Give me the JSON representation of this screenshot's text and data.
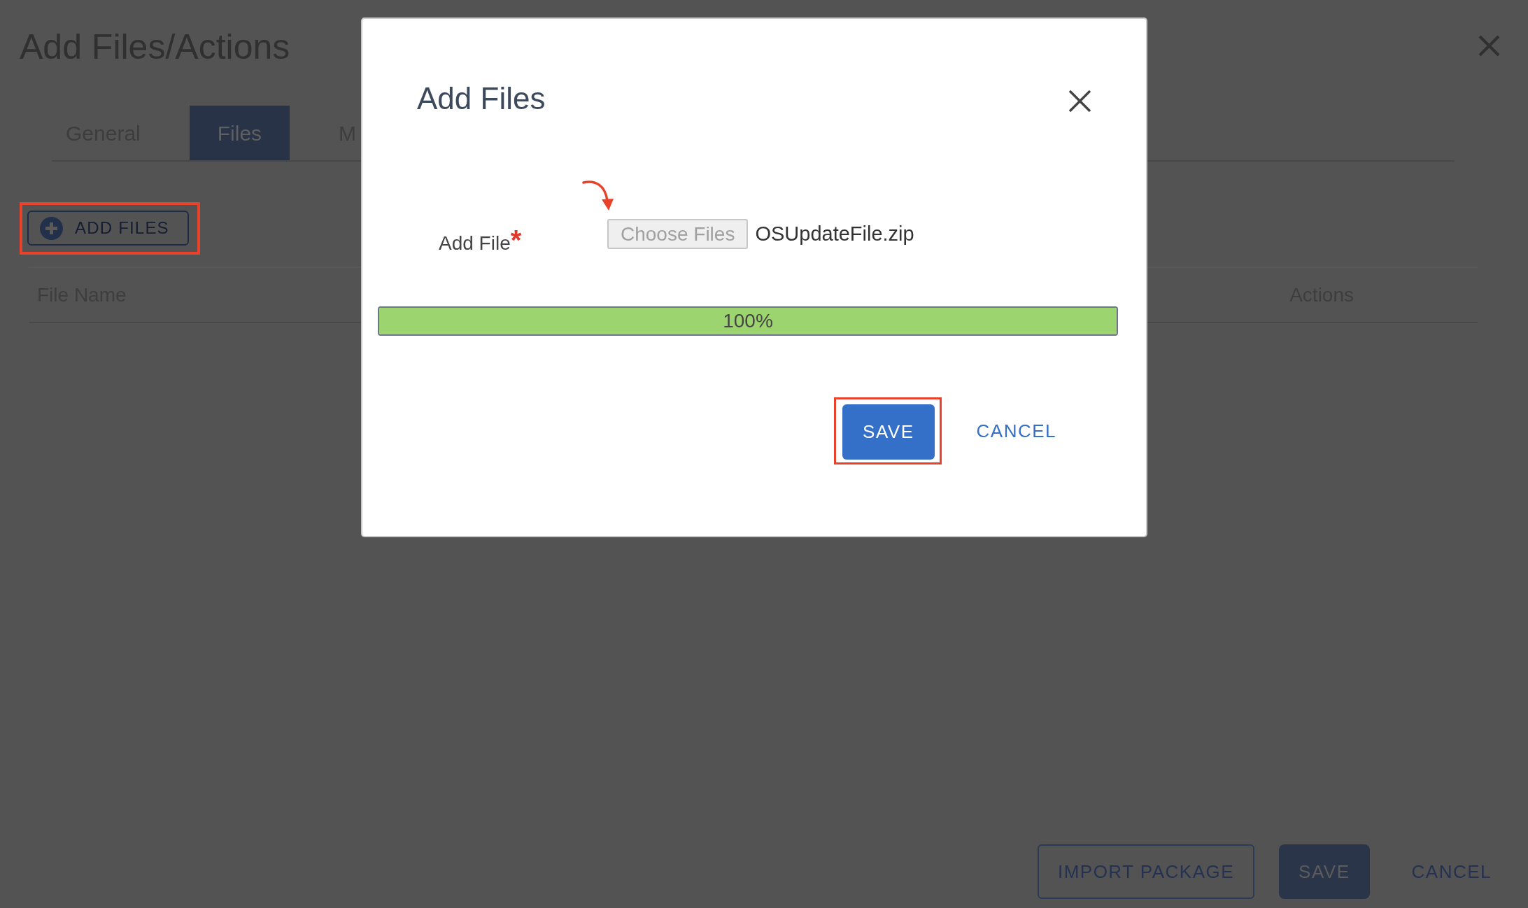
{
  "page": {
    "title": "Add Files/Actions",
    "tabs": [
      {
        "label": "General",
        "selected": false
      },
      {
        "label": "Files",
        "selected": true
      },
      {
        "label": "M",
        "selected": false
      }
    ],
    "add_files_button": {
      "label": "ADD FILES",
      "highlighted": true
    },
    "table": {
      "columns": [
        "File Name",
        "Actions"
      ]
    },
    "footer_buttons": [
      {
        "label": "IMPORT PACKAGE",
        "kind": "outline"
      },
      {
        "label": "SAVE",
        "kind": "primary"
      },
      {
        "label": "CANCEL",
        "kind": "link"
      }
    ]
  },
  "dialog": {
    "title": "Add Files",
    "field": {
      "label": "Add File",
      "required_mark": "*",
      "button": "Choose Files",
      "value": "OSUpdateFile.zip",
      "annotation_arrow": true
    },
    "progress": {
      "level": 1.0,
      "reading": "100%"
    },
    "buttons": [
      {
        "label": "SAVE",
        "kind": "primary",
        "highlighted": true
      },
      {
        "label": "CANCEL",
        "kind": "link",
        "highlighted": false
      }
    ]
  }
}
